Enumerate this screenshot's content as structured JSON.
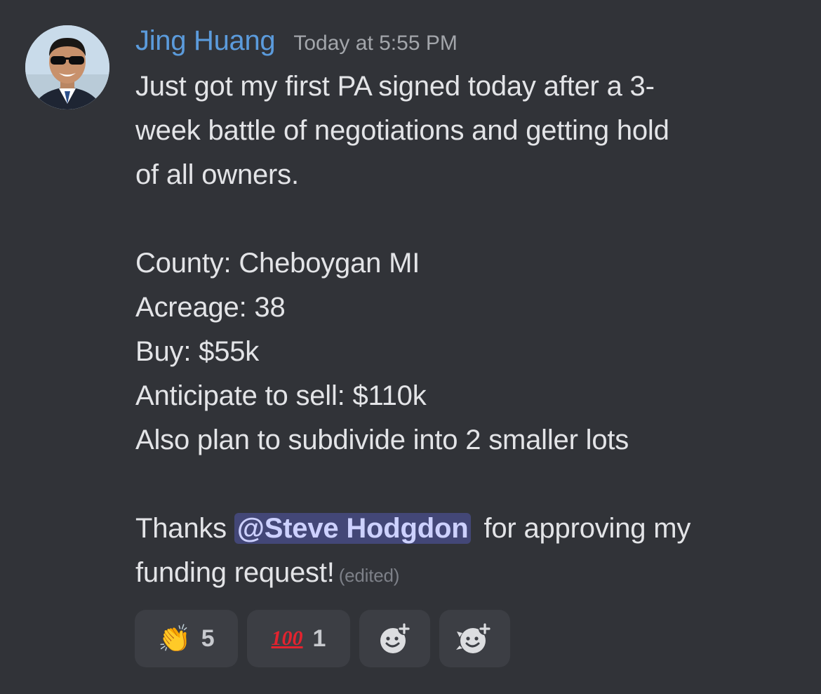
{
  "message": {
    "author": "Jing Huang",
    "timestamp": "Today at 5:55 PM",
    "lines": [
      "Just got my first PA signed today after a 3-",
      "week battle of negotiations and getting hold",
      "of all owners.",
      "County: Cheboygan MI",
      "Acreage: 38",
      "Buy: $55k",
      "Anticipate to sell: $110k",
      "Also plan to subdivide into 2 smaller lots"
    ],
    "thanks_prefix": "Thanks",
    "mention": "@Steve Hodgdon",
    "thanks_suffix": "for approving my",
    "final_line": "funding request!",
    "edited_label": "(edited)"
  },
  "reactions": [
    {
      "emoji": "👏",
      "name": "clapping-hands",
      "count": "5"
    },
    {
      "emoji": "100",
      "name": "hundred-points",
      "count": "1"
    }
  ],
  "add_reaction_icons": [
    "add-reaction-icon",
    "add-super-reaction-icon"
  ],
  "colors": {
    "background": "#313338",
    "username": "#5b9bdc",
    "mention_bg": "#434777",
    "mention_text": "#cdd1ff",
    "reaction_bg": "#3c3e44"
  }
}
